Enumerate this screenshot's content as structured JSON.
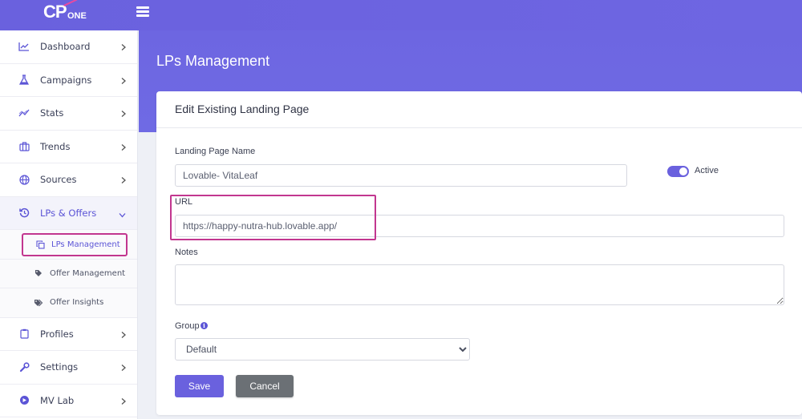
{
  "header": {
    "logo_main": "CP",
    "logo_sub": "ONE"
  },
  "sidebar": {
    "items": [
      {
        "label": "Dashboard",
        "icon": "chart-line-icon"
      },
      {
        "label": "Campaigns",
        "icon": "flask-icon"
      },
      {
        "label": "Stats",
        "icon": "trend-icon"
      },
      {
        "label": "Trends",
        "icon": "briefcase-icon"
      },
      {
        "label": "Sources",
        "icon": "globe-icon"
      },
      {
        "label": "LPs & Offers",
        "icon": "history-icon"
      },
      {
        "label": "Profiles",
        "icon": "clipboard-icon"
      },
      {
        "label": "Settings",
        "icon": "wrench-icon"
      },
      {
        "label": "MV Lab",
        "icon": "compass-icon"
      }
    ],
    "subitems": [
      {
        "label": "LPs Management",
        "icon": "copy-icon"
      },
      {
        "label": "Offer Management",
        "icon": "tag-icon"
      },
      {
        "label": "Offer Insights",
        "icon": "tags-icon"
      }
    ]
  },
  "page": {
    "title": "LPs Management"
  },
  "card": {
    "title": "Edit Existing Landing Page"
  },
  "form": {
    "name_label": "Landing Page Name",
    "name_value": "Lovable- VitaLeaf",
    "active_label": "Active",
    "url_label": "URL",
    "url_value": "https://happy-nutra-hub.lovable.app/",
    "notes_label": "Notes",
    "notes_value": "",
    "group_label": "Group",
    "group_value": "Default",
    "save_label": "Save",
    "cancel_label": "Cancel"
  },
  "colors": {
    "accent": "#6a61de",
    "highlight": "#c2368f",
    "cancel": "#6b7075"
  }
}
